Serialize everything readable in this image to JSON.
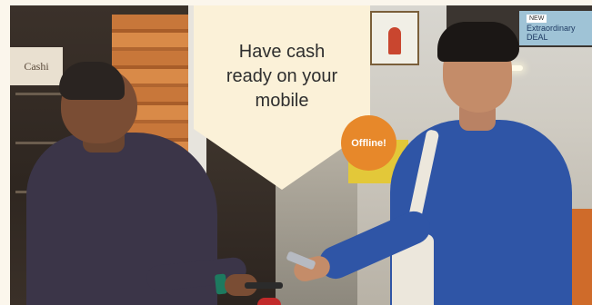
{
  "hero": {
    "headline": "Have cash\nready on your\nmobile",
    "badge": "Offline!"
  },
  "scene": {
    "storefront_sign_text": "Cashi",
    "ad_banner": {
      "tag": "NEW",
      "text": "Extraordinary DEAL"
    }
  },
  "colors": {
    "page_background": "#fbf6ec",
    "pennant": "#fbf1d8",
    "badge": "#e7882a",
    "headline_text": "#2e2e2e"
  }
}
